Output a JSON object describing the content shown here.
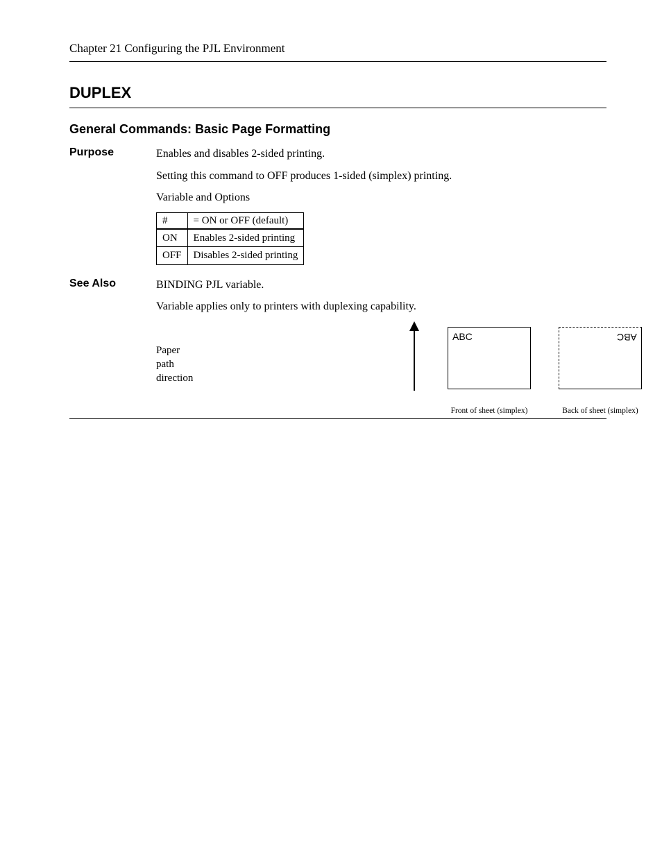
{
  "header": {
    "chapter": "Chapter 21 Configuring the PJL Environment"
  },
  "heading": "DUPLEX",
  "subsection": "General Commands: Basic Page Formatting",
  "purpose": {
    "label": "Purpose",
    "line1": "Enables and disables 2-sided printing.",
    "line2": "Setting this command to OFF produces 1-sided (simplex) printing.",
    "line3": "Variable and Options"
  },
  "table": {
    "h1": "#",
    "h2": "= ON or OFF (default)",
    "r1a": "ON",
    "r1b": "Enables 2-sided printing",
    "r2a": "OFF",
    "r2b": "Disables 2-sided printing"
  },
  "see_also": {
    "label": "See Also",
    "line1": "BINDING PJL variable.",
    "line2": "Variable applies only to printers with duplexing capability."
  },
  "figure": {
    "arrow_label": "Paper\npath\ndirection",
    "abc": "ABC",
    "cap_front": "Front of sheet (simplex)",
    "cap_back": "Back of sheet (simplex)"
  }
}
